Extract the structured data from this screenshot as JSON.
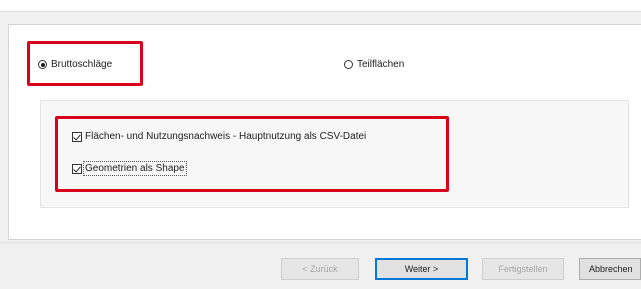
{
  "options": {
    "bruttoschlaege_label": "Bruttoschläge",
    "teilflaechen_label": "Teilflächen",
    "selected": "Bruttoschläge"
  },
  "exports": {
    "items": [
      {
        "label": "Flächen- und Nutzungsnachweis - Hauptnutzung als CSV-Datei",
        "checked": true
      },
      {
        "label": "Geometrien als Shape",
        "checked": true
      }
    ]
  },
  "buttons": {
    "back_label": "< Zurück",
    "next_label": "Weiter >",
    "finish_label": "Fertigstellen",
    "cancel_label": "Abbrechen"
  },
  "colors": {
    "highlight": "#d9001b",
    "default_button_border": "#0078d7"
  }
}
